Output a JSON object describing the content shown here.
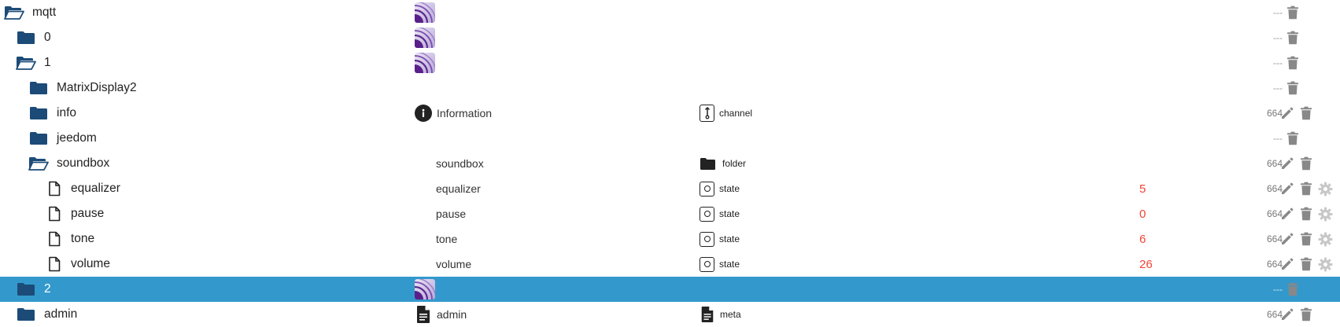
{
  "colors": {
    "folder": "#1c4b78",
    "selected_row": "#3399cc",
    "value": "#f44336",
    "icon_gray": "#888888"
  },
  "rows": [
    {
      "name": "mqtt",
      "icon": "folder-open-icon",
      "role_icon": "mqtt-adapter-logo",
      "role": "",
      "type_icon": "",
      "type": "",
      "value": "",
      "acl": "---",
      "actions": [
        "delete"
      ]
    },
    {
      "name": "0",
      "icon": "folder-icon",
      "role_icon": "mqtt-adapter-logo",
      "role": "",
      "type_icon": "",
      "type": "",
      "value": "",
      "acl": "---",
      "actions": [
        "delete"
      ]
    },
    {
      "name": "1",
      "icon": "folder-open-icon",
      "role_icon": "mqtt-adapter-logo",
      "role": "",
      "type_icon": "",
      "type": "",
      "value": "",
      "acl": "---",
      "actions": [
        "delete"
      ]
    },
    {
      "name": "MatrixDisplay2",
      "icon": "folder-icon",
      "role_icon": "",
      "role": "",
      "type_icon": "",
      "type": "",
      "value": "",
      "acl": "---",
      "actions": [
        "delete"
      ]
    },
    {
      "name": "info",
      "icon": "folder-icon",
      "role_icon": "info-icon",
      "role": "Information",
      "type_icon": "channel-icon",
      "type": "channel",
      "value": "",
      "acl": "664",
      "actions": [
        "edit",
        "delete"
      ]
    },
    {
      "name": "jeedom",
      "icon": "folder-icon",
      "role_icon": "",
      "role": "",
      "type_icon": "",
      "type": "",
      "value": "",
      "acl": "---",
      "actions": [
        "delete"
      ]
    },
    {
      "name": "soundbox",
      "icon": "folder-open-icon",
      "role_icon": "",
      "role": "soundbox",
      "type_icon": "folder-type-icon",
      "type": "folder",
      "value": "",
      "acl": "664",
      "actions": [
        "edit",
        "delete"
      ]
    },
    {
      "name": "equalizer",
      "icon": "file-icon",
      "role_icon": "",
      "role": "equalizer",
      "type_icon": "state-icon",
      "type": "state",
      "value": "5",
      "acl": "664",
      "actions": [
        "edit",
        "delete",
        "settings"
      ]
    },
    {
      "name": "pause",
      "icon": "file-icon",
      "role_icon": "",
      "role": "pause",
      "type_icon": "state-icon",
      "type": "state",
      "value": "0",
      "acl": "664",
      "actions": [
        "edit",
        "delete",
        "settings"
      ]
    },
    {
      "name": "tone",
      "icon": "file-icon",
      "role_icon": "",
      "role": "tone",
      "type_icon": "state-icon",
      "type": "state",
      "value": "6",
      "acl": "664",
      "actions": [
        "edit",
        "delete",
        "settings"
      ]
    },
    {
      "name": "volume",
      "icon": "file-icon",
      "role_icon": "",
      "role": "volume",
      "type_icon": "state-icon",
      "type": "state",
      "value": "26",
      "acl": "664",
      "actions": [
        "edit",
        "delete",
        "settings"
      ]
    },
    {
      "name": "2",
      "icon": "folder-icon",
      "role_icon": "mqtt-adapter-logo",
      "role": "",
      "type_icon": "",
      "type": "",
      "value": "",
      "acl": "---",
      "actions": [
        "delete"
      ],
      "selected": true
    },
    {
      "name": "admin",
      "icon": "folder-icon",
      "role_icon": "meta-file-icon",
      "role": "admin",
      "type_icon": "meta-file-icon",
      "type": "meta",
      "value": "",
      "acl": "664",
      "actions": [
        "edit",
        "delete"
      ]
    }
  ]
}
